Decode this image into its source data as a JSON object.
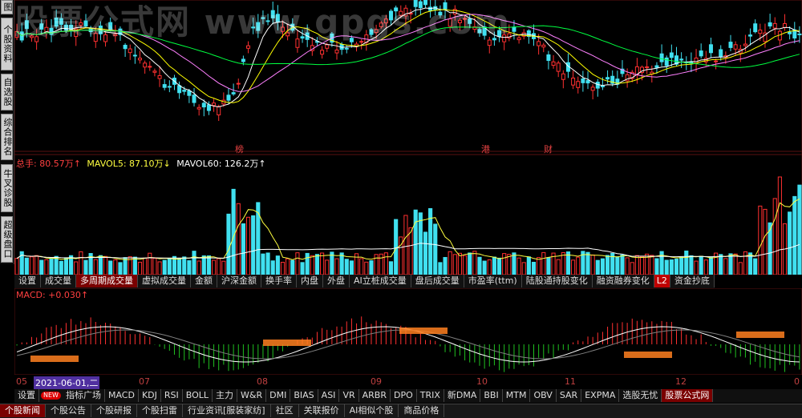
{
  "sidebar": {
    "tabs": [
      {
        "label": "图",
        "name": "sidebar-tab-chart"
      },
      {
        "label": "个股资料",
        "name": "sidebar-tab-stock-info"
      },
      {
        "label": "自选股",
        "name": "sidebar-tab-watchlist"
      },
      {
        "label": "综合排名",
        "name": "sidebar-tab-ranking"
      },
      {
        "label": "牛叉诊股",
        "name": "sidebar-tab-diagnosis"
      },
      {
        "label": "超级盘口",
        "name": "sidebar-tab-super-order"
      }
    ]
  },
  "watermark": "股票公式网 www.gpgs.com",
  "price_markers": [
    {
      "label": "榜"
    },
    {
      "label": "港"
    },
    {
      "label": "财"
    }
  ],
  "volume_legend": {
    "total_label": "总手: 80.57万↑",
    "mavol5_label": "MAVOL5: 87.10万↓",
    "mavol60_label": "MAVOL60: 126.2万↑",
    "colors": {
      "total": "#ff4040",
      "mavol5": "#ffff40",
      "mavol60": "#ffffff"
    }
  },
  "volume_tabs": [
    "设置",
    "成交量",
    "多周期成交量",
    "虚拟成交量",
    "金额",
    "沪深金额",
    "换手率",
    "内盘",
    "外盘",
    "AI立桩成交量",
    "盘后成交量",
    "市盈率(ttm)",
    "陆股通持股变化",
    "融资融券变化",
    "L2",
    "资金抄底"
  ],
  "volume_active_tab": "多周期成交量",
  "macd_legend": {
    "label": "MACD: +0.030↑",
    "color": "#ff4040"
  },
  "date_axis": {
    "labels": [
      "05",
      "2021-06-01,二",
      "07",
      "08",
      "09",
      "10",
      "11",
      "12",
      "0"
    ]
  },
  "indicator_bar": {
    "settings": "设置",
    "new_badge": "NEW",
    "tabs": [
      "指标广场",
      "MACD",
      "KDJ",
      "RSI",
      "BOLL",
      "主力",
      "W&R",
      "DMI",
      "BIAS",
      "ASI",
      "VR",
      "ARBR",
      "DPO",
      "TRIX",
      "新DMA",
      "BBI",
      "MTM",
      "OBV",
      "SAR",
      "EXPMA",
      "选股无忧",
      "股票公式网"
    ],
    "active": "股票公式网"
  },
  "bottom_tabs": {
    "tabs": [
      "个股新闻",
      "个股公告",
      "个股研报",
      "个股扫雷",
      "行业资讯[服装家纺]",
      "社区",
      "关联报价",
      "AI相似个股",
      "商品价格"
    ],
    "active": "个股新闻"
  },
  "colors": {
    "up": "#ff3030",
    "down": "#40e0f0",
    "ma5": "#ffffff",
    "ma10": "#ffff00",
    "ma20": "#ff80ff",
    "ma60": "#00ff40",
    "panel_border": "#5a1010",
    "macd_pos": "#ff3030",
    "macd_neg": "#20c020"
  }
}
